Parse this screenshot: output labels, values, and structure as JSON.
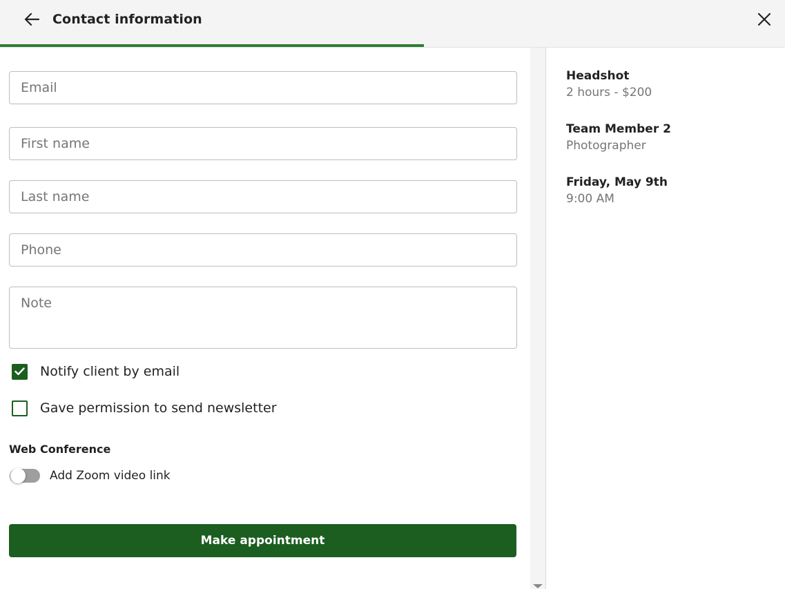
{
  "header": {
    "title": "Contact information",
    "back_icon": "arrow-left-icon",
    "close_icon": "close-icon",
    "progress_percent": 80,
    "progress_color": "#2e7d32"
  },
  "form": {
    "email_placeholder": "Email",
    "first_name_placeholder": "First name",
    "last_name_placeholder": "Last name",
    "phone_placeholder": "Phone",
    "note_placeholder": "Note",
    "notify_label": "Notify client by email",
    "notify_checked": true,
    "newsletter_label": "Gave permission to send newsletter",
    "newsletter_checked": false,
    "web_conference_title": "Web Conference",
    "zoom_label": "Add Zoom video link",
    "zoom_enabled": false,
    "submit_label": "Make appointment",
    "accent_color": "#1b5e20"
  },
  "summary": {
    "service_name": "Headshot",
    "service_detail": "2 hours - $200",
    "staff_name": "Team Member 2",
    "staff_role": "Photographer",
    "date": "Friday, May 9th",
    "time": "9:00 AM"
  }
}
